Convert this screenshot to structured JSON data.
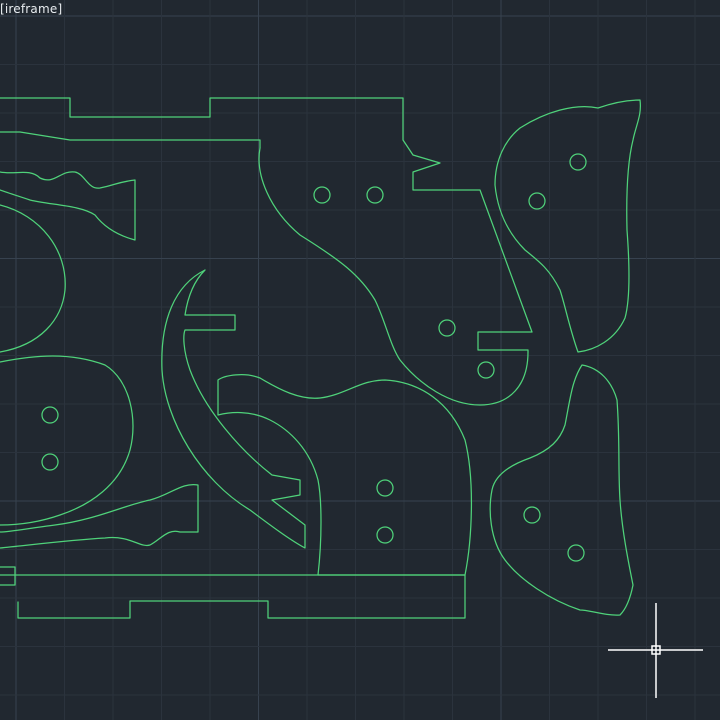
{
  "viewport": {
    "visual_style_label": "[ireframe]",
    "colors": {
      "background": "#212830",
      "grid_minor": "#2b333d",
      "grid_major": "#37424f",
      "geometry": "#4fd27a",
      "crosshair": "#ffffff"
    }
  },
  "drawing": {
    "entities": [
      "frame-outline",
      "upper-left-bone",
      "upper-left-round-lobe",
      "center-claw",
      "center-s-curve-panel",
      "lower-left-oval",
      "lower-left-bone",
      "lower-center-blob",
      "right-upper-cam",
      "right-lower-cam"
    ]
  },
  "cursor": {
    "icon": "crosshair-cursor"
  }
}
